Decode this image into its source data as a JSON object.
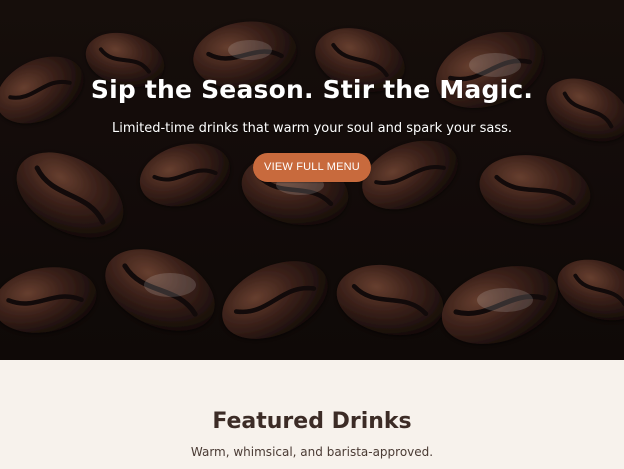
{
  "hero": {
    "title": "Sip the Season. Stir the Magic.",
    "subtitle": "Limited-time drinks that warm your soul and spark your sass.",
    "cta_label": "VIEW FULL MENU",
    "image_subject": "coffee beans"
  },
  "featured": {
    "title": "Featured Drinks",
    "subtitle": "Warm, whimsical, and barista-approved."
  },
  "colors": {
    "accent": "#c86a3d",
    "page_bg": "#f7f2ec",
    "heading": "#3c2c26"
  }
}
